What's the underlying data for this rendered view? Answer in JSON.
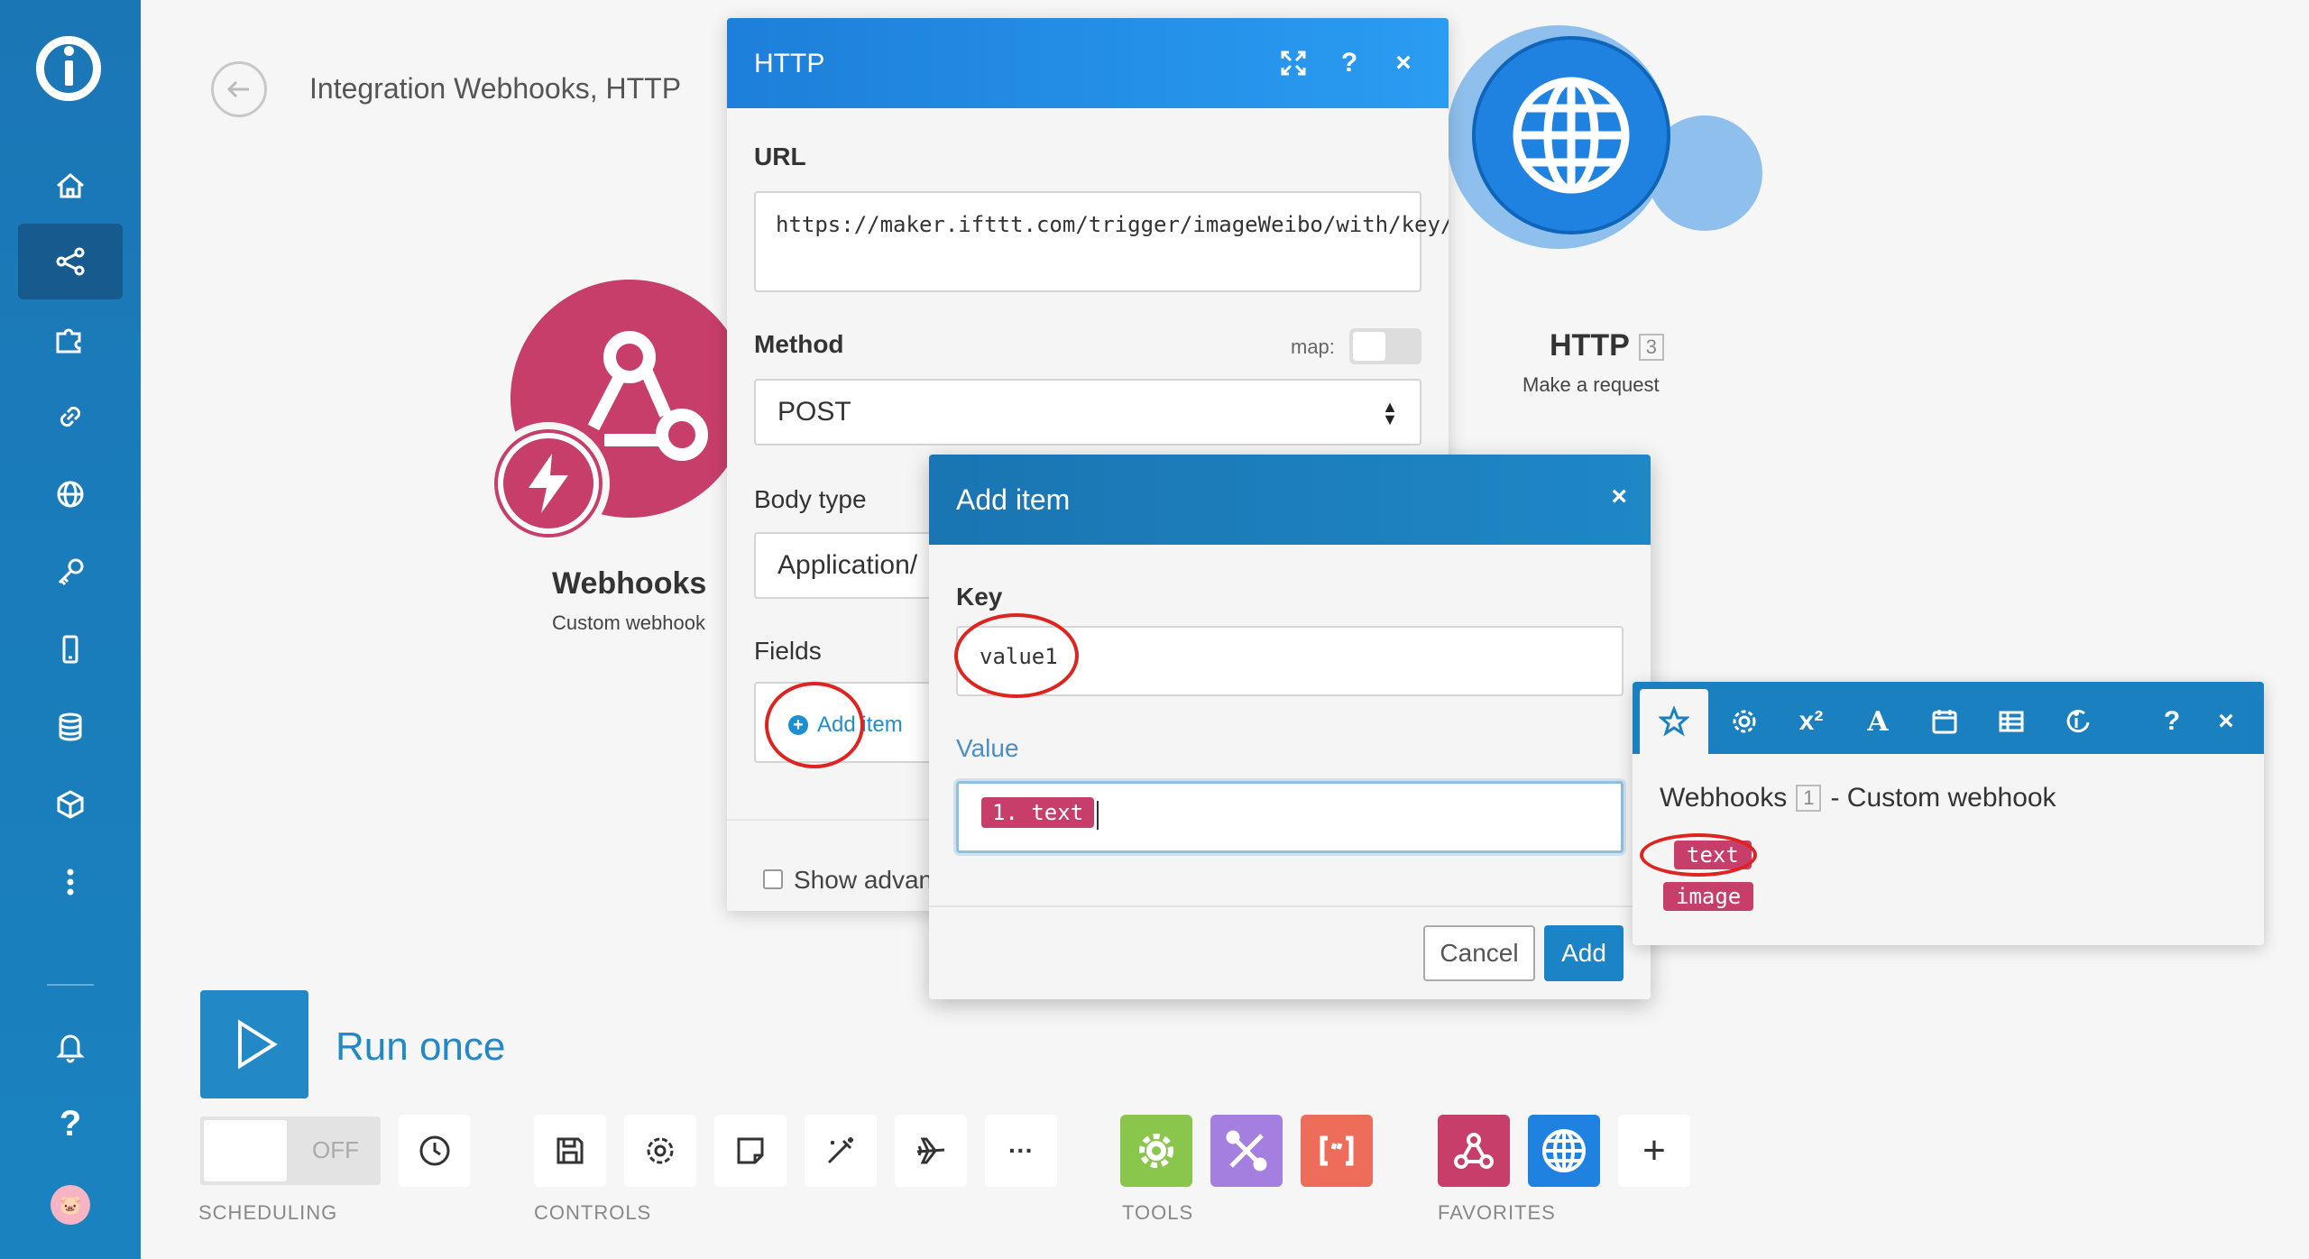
{
  "header": {
    "title": "Integration Webhooks, HTTP"
  },
  "modules": {
    "webhooks": {
      "name": "Webhooks",
      "subtitle": "Custom webhook",
      "color": "#c83e6a"
    },
    "http": {
      "name": "HTTP",
      "number": "3",
      "subtitle": "Make a request",
      "color": "#1f82e0"
    }
  },
  "http_panel": {
    "title": "HTTP",
    "icons": [
      "expand-icon",
      "help-icon",
      "close-icon"
    ],
    "help_glyph": "?",
    "close_glyph": "×",
    "url_label": "URL",
    "url_value": "https://maker.ifttt.com/trigger/imageWeibo/with/key/xxxxxxxx",
    "method_label": "Method",
    "map_label": "map:",
    "method_value": "POST",
    "body_type_label": "Body type",
    "body_type_value": "Application/",
    "fields_label": "Fields",
    "add_item_label": "Add item",
    "show_advanced_label": "Show advan"
  },
  "add_item_dialog": {
    "title": "Add item",
    "close_glyph": "×",
    "key_label": "Key",
    "key_value": "value1",
    "value_label": "Value",
    "value_pill": "1. text",
    "cancel_label": "Cancel",
    "add_label": "Add"
  },
  "mapping_panel": {
    "tabs": [
      "star-icon",
      "gear-icon",
      "superscript-icon",
      "text-icon",
      "calendar-icon",
      "table-icon",
      "integromat-icon",
      "help-icon",
      "close-icon"
    ],
    "superscript_glyph": "x²",
    "text_glyph": "A",
    "help_glyph": "?",
    "close_glyph": "×",
    "title": "Webhooks",
    "title_number": "1",
    "title_suffix": "- Custom webhook",
    "items": [
      "text",
      "image"
    ]
  },
  "bottom_toolbar": {
    "run_label": "Run once",
    "scheduling_state": "OFF",
    "sections": {
      "scheduling": "SCHEDULING",
      "controls": "CONTROLS",
      "tools": "TOOLS",
      "favorites": "FAVORITES"
    },
    "more_glyph": "···",
    "add_glyph": "+",
    "tools_colors": [
      "#8ac64b",
      "#a57fe0",
      "#ee6d5a"
    ],
    "favorites_colors": [
      "#c83e6a",
      "#1f82e0"
    ]
  },
  "sidebar": {
    "items": [
      "home-icon",
      "share-icon",
      "puzzle-icon",
      "link-icon",
      "globe-icon",
      "key-icon",
      "phone-icon",
      "database-icon",
      "box-icon",
      "more-icon",
      "bell-icon",
      "help-icon"
    ],
    "help_glyph": "?",
    "avatar_glyph": "🐷",
    "accent": "#1b76b6"
  }
}
